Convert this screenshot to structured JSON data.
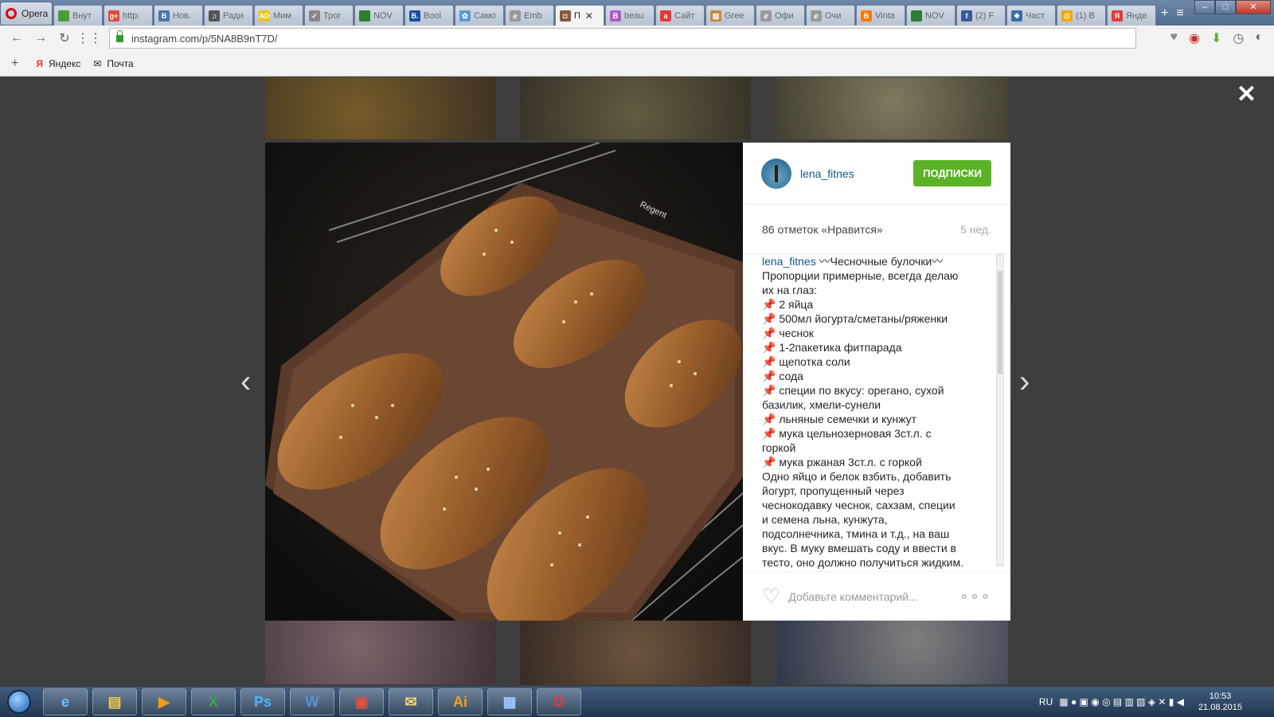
{
  "browser": {
    "name": "Opera",
    "tabs": [
      {
        "label": "Внут",
        "fav": "#4b9e3a",
        "glyph": ""
      },
      {
        "label": "http:",
        "fav": "#dd4b39",
        "glyph": "g+"
      },
      {
        "label": "Нов.",
        "fav": "#4a76a8",
        "glyph": "B"
      },
      {
        "label": "Ради",
        "fav": "#555",
        "glyph": "♫"
      },
      {
        "label": "Мим",
        "fav": "#f1c40f",
        "glyph": "AD"
      },
      {
        "label": "Трог",
        "fav": "#888",
        "glyph": "✓"
      },
      {
        "label": "NOV",
        "fav": "#2e7d32",
        "glyph": ""
      },
      {
        "label": "Bool",
        "fav": "#1a4fa0",
        "glyph": "B."
      },
      {
        "label": "Само",
        "fav": "#5b9bd5",
        "glyph": "✿"
      },
      {
        "label": "Emb",
        "fav": "#999",
        "glyph": "ℯ"
      },
      {
        "label": "П",
        "fav": "#8a5a3b",
        "glyph": "◘",
        "active": true
      },
      {
        "label": "beau",
        "fav": "#b05cc7",
        "glyph": "B"
      },
      {
        "label": "Сайт",
        "fav": "#e53935",
        "glyph": "a"
      },
      {
        "label": "Gree",
        "fav": "#c58b3f",
        "glyph": "▧"
      },
      {
        "label": "Офи",
        "fav": "#999",
        "glyph": "ℯ"
      },
      {
        "label": "Очи",
        "fav": "#999",
        "glyph": "ℯ"
      },
      {
        "label": "Vinta",
        "fav": "#f57c00",
        "glyph": "B"
      },
      {
        "label": "NOV",
        "fav": "#2e7d32",
        "glyph": ""
      },
      {
        "label": "(2) F",
        "fav": "#3b5998",
        "glyph": "f"
      },
      {
        "label": "Част",
        "fav": "#3d6dab",
        "glyph": "❖"
      },
      {
        "label": "(1) B",
        "fav": "#f6a400",
        "glyph": "@"
      },
      {
        "label": "Янде",
        "fav": "#e53935",
        "glyph": "Я"
      }
    ],
    "url": "instagram.com/p/5NA8B9nT7D/",
    "bookmarks": [
      {
        "label": "Яндекс",
        "icon": "yandex-icon"
      },
      {
        "label": "Почта",
        "icon": "mail-icon"
      }
    ]
  },
  "post": {
    "username": "lena_fitnes",
    "follow_label": "ПОДПИСКИ",
    "likes": "86 отметок «Нравится»",
    "age": "5 нед.",
    "caption_title": "〰Чесночные булочки〰",
    "caption_lines": [
      "Пропорции примерные, всегда делаю",
      "их на глаз:",
      "📌 2 яйца",
      "📌 500мл йогурта/сметаны/ряженки",
      "📌 чеснок",
      "📌 1-2пакетика фитпарада",
      "📌 щепотка соли",
      "📌 сода",
      "📌 специи по вкусу: орегано, сухой",
      "базилик, хмели-сунели",
      "📌 льняные семечки и кунжут",
      "📌 мука цельнозерновая 3ст.л. с",
      "горкой",
      "📌 мука ржаная 3ст.л. с горкой",
      "Одно яйцо и белок взбить, добавить",
      "йогурт, пропущенный через",
      "чеснокодавку чеснок, сахзам, специи",
      "и семена льна, кунжута,",
      "подсолнечника, тмина и т.д., на ваш",
      "вкус. В муку вмешать соду и ввести в",
      "тесто, оно должно получиться жидким."
    ],
    "comment_placeholder": "Добавьте комментарий...",
    "pan_brand": "Regent"
  },
  "taskbar": {
    "lang": "RU",
    "time": "10:53",
    "date": "21.08.2015",
    "apps": [
      "ie",
      "explorer",
      "media",
      "excel",
      "photoshop",
      "word",
      "acrobat",
      "outlook",
      "illustrator",
      "network",
      "opera"
    ]
  },
  "colors": {
    "follow": "#5cb227",
    "link": "#125688"
  }
}
